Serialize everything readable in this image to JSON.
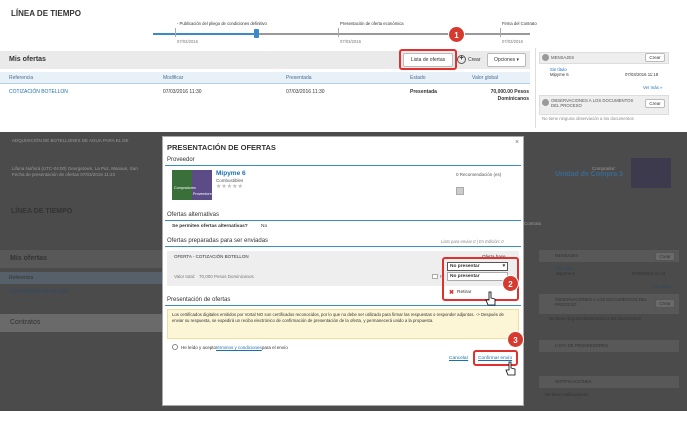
{
  "top": {
    "timeline_title": "LÍNEA DE TIEMPO",
    "timeline": [
      {
        "label": "- Publicación del pliego de condiciones definitivo",
        "date": "07/03/2016"
      },
      {
        "label": "Presentación de oferta económica",
        "date": "07/03/2016"
      },
      {
        "label": "Firma del Contrato",
        "date": "07/03/2016"
      }
    ],
    "ofertas_title": "Mis ofertas",
    "btn_lista": "Lista de ofertas",
    "btn_crear": "Crear",
    "btn_opciones": "Opciones",
    "table_headers": [
      "Referencia",
      "Modificar",
      "Presentada",
      "Estado",
      "Valor global"
    ],
    "row": {
      "ref": "COTIZACIÓN BOTELLON",
      "mod": "07/03/2016 11:30",
      "pres": "07/03/2016 11:30",
      "estado": "Presentada",
      "valor": "70,000.00 Pesos Dominicanos"
    },
    "side": {
      "mensajes": "MENSAJES",
      "crear": "Crear",
      "sin_titulo": "Sin título",
      "sender": "Mipyme 6",
      "msg_date": "07/03/2016 11:18",
      "ver_mas": "Ver más »",
      "obs_title": "OBSERVACIONES A LOS DOCUMENTOS DEL PROCESO",
      "obs_empty": "No tiene ninguna observación a los documentos"
    }
  },
  "bg": {
    "line1": "ADQUISICIÓN DE BOTELLONES DE AGUA PARA EL DE",
    "line2": "Lifuna Nuñorá (UTC-04:00) Georgetown, La Paz, Manaus, San",
    "line3": "Fecha de presentación de ofertas 07/03/2016 11:23",
    "comprador_lbl": "Comprador:",
    "comprador": "Unidad de Compra 3",
    "timeline_title": "LÍNEA DE TIEMPO",
    "ofertas_title": "Mis ofertas",
    "referencia": "Referencia",
    "row_ref": "COTIZACIÓN BOTELLON",
    "contratos": "Contratos",
    "contrato_lbl": "Contrato",
    "side_mensajes": "MENSAJES",
    "side_crear": "Crear",
    "side_sin_titulo": "Sin título",
    "side_sender": "Mipyme 6",
    "side_date": "07/03/2016 11:18",
    "side_ver_mas": "Ver más »",
    "side_obs": "OBSERVACIONES A LOS DOCUMENTOS DEL PROCESO",
    "side_obs_empty": "No tiene ninguna observación a los documentos",
    "side_lista_prov": "LISTA DE PROVEEDORES",
    "side_notif": "NOTIFICACIONES",
    "side_notif_empty": "No tiene notificaciones"
  },
  "modal": {
    "title": "PRESENTACIÓN DE OFERTAS",
    "close": "×",
    "s_proveedor": "Proveedor",
    "prov_name": "Mipyme 6",
    "prov_sub": "Combustibles",
    "stars": "★★★★★",
    "recomendacion": "0 Recomendación (es)",
    "logo_left": "Compradores",
    "logo_right": "Proveedores",
    "s_alternativas": "Ofertas alternativas",
    "alt_q": "Se permiten ofertas alternativas?",
    "alt_a": "No",
    "s_preparadas": "Ofertas preparadas para ser enviadas",
    "listo": "Listo para enviar 0 | En Edición: 0",
    "oferta_name": "OFERTA - COTIZACIÓN BOTELLON",
    "oferta_base": "Oferta base",
    "valor_total_lbl": "Valor total:",
    "valor_total": "70,000 Pesos Dominicanos",
    "pres_abbr": "Pr",
    "select_value": "No presentar",
    "select_option": "No presentar",
    "retirar": "Retirar",
    "s_presentacion": "Presentación de ofertas",
    "notice": "Los certificados digitales emitidos por Vortal NO son certificados reconocidos, por lo que no debe ser utilizado para firmar las respuestas o responder adjuntos. -> Después de enviar su respuesta, se expedirá un recibo electrónico de confirmación de presentación de la oferta, y permanecerá unido a la propuesta.",
    "terms_pre": "He leído y acepto",
    "terms_link": "términos y condiciones",
    "terms_post": "para el envío",
    "cancelar": "Cancelar",
    "confirmar": "Confirmar envío"
  },
  "badges": [
    "1",
    "2",
    "3"
  ]
}
